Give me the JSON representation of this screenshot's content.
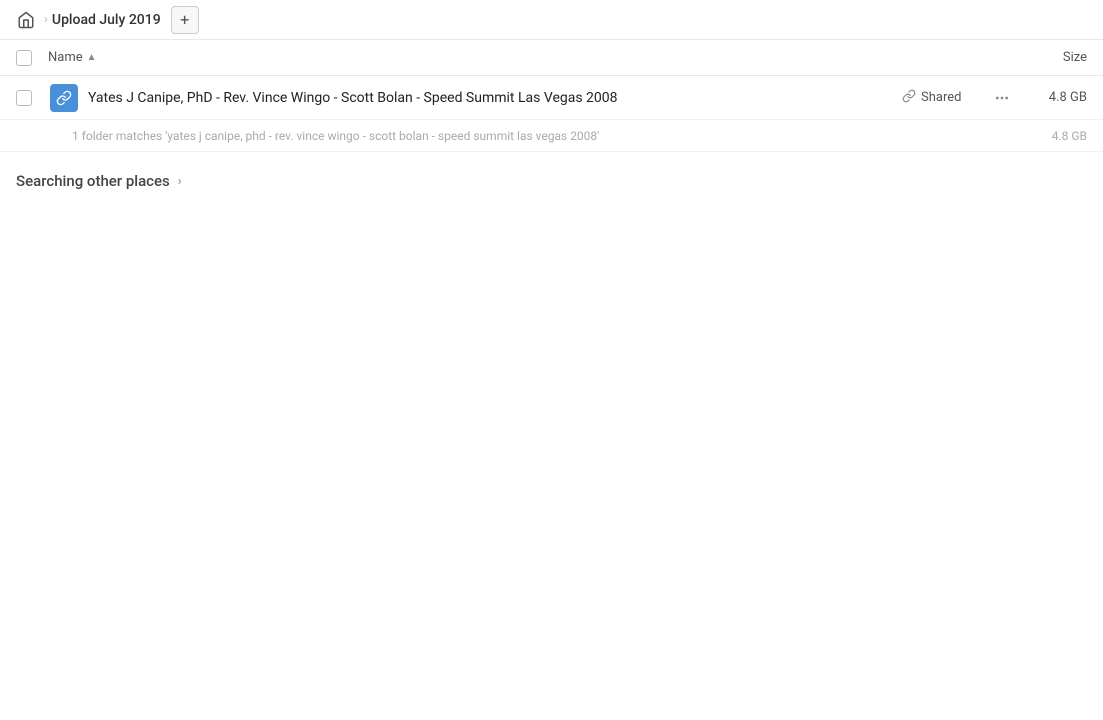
{
  "header": {
    "home_icon": "home",
    "breadcrumb_separator": "›",
    "title": "Upload July 2019",
    "add_button_label": "+"
  },
  "columns": {
    "name_label": "Name",
    "sort_arrow": "▲",
    "size_label": "Size"
  },
  "file_row": {
    "name": "Yates J Canipe, PhD - Rev. Vince Wingo - Scott Bolan - Speed Summit Las Vegas 2008",
    "shared_label": "Shared",
    "size": "4.8 GB",
    "more_icon": "•••"
  },
  "sub_match": {
    "text": "1 folder matches 'yates j canipe, phd - rev. vince wingo - scott bolan - speed summit las vegas 2008'",
    "size": "4.8 GB"
  },
  "searching": {
    "label": "Searching other places",
    "chevron": "›"
  }
}
